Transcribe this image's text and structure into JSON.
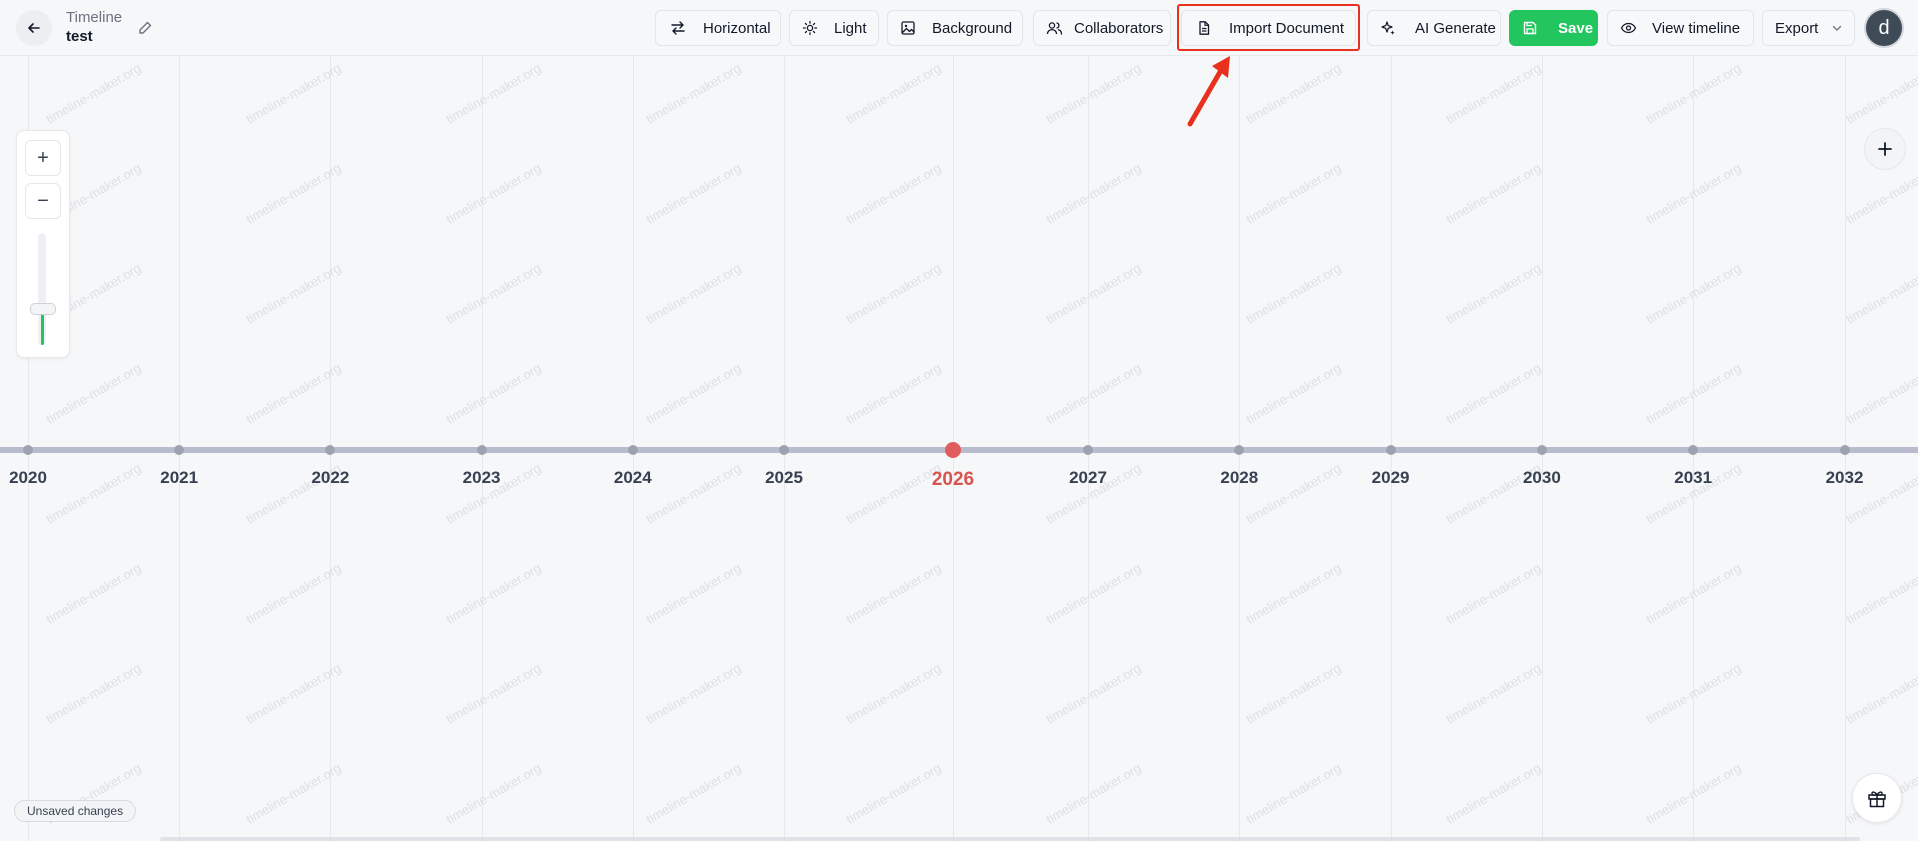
{
  "header": {
    "title_label": "Timeline",
    "title_name": "test"
  },
  "toolbar": {
    "buttons": [
      {
        "name": "orientation-button",
        "icon": "swap-arrows-icon",
        "label": "Horizontal"
      },
      {
        "name": "theme-button",
        "icon": "sun-icon",
        "label": "Light"
      },
      {
        "name": "background-button",
        "icon": "image-icon",
        "label": "Background"
      },
      {
        "name": "collaborators-button",
        "icon": "users-icon",
        "label": "Collaborators"
      },
      {
        "name": "import-document-button",
        "icon": "document-icon",
        "label": "Import Document"
      },
      {
        "name": "ai-generate-button",
        "icon": "sparkles-icon",
        "label": "AI Generate"
      },
      {
        "name": "save-button",
        "icon": "save-icon",
        "label": "Save"
      },
      {
        "name": "view-timeline-button",
        "icon": "eye-icon",
        "label": "View timeline"
      },
      {
        "name": "export-button",
        "icon": "chevron-down-icon",
        "label": "Export"
      }
    ],
    "avatar_initial": "d"
  },
  "timeline": {
    "years": [
      "2020",
      "2021",
      "2022",
      "2023",
      "2024",
      "2025",
      "2026",
      "2027",
      "2028",
      "2029",
      "2030",
      "2031",
      "2032"
    ],
    "current_year": "2026",
    "watermark": "timeline-maker.org"
  },
  "zoom": {
    "zoom_in": "+",
    "zoom_out": "−",
    "level": 0.3
  },
  "status": {
    "unsaved": "Unsaved changes"
  },
  "colors": {
    "save_green": "#22c55e",
    "current_year_red": "#d9534f",
    "highlight_red": "#e8301c"
  }
}
